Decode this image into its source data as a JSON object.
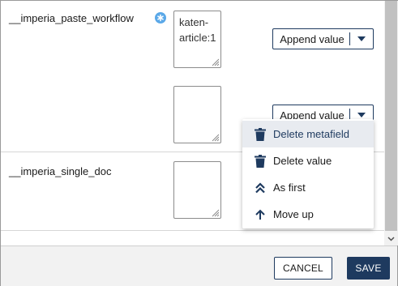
{
  "fields": [
    {
      "label": "__imperia_paste_workflow",
      "has_info_icon": true,
      "values": [
        "katen-article:1",
        ""
      ],
      "append_label": "Append value"
    },
    {
      "label": "__imperia_single_doc",
      "values": [
        ""
      ]
    }
  ],
  "value_menu": {
    "items": [
      {
        "label": "Delete metafield",
        "icon": "trash-icon",
        "active": true
      },
      {
        "label": "Delete value",
        "icon": "trash-icon",
        "active": false
      },
      {
        "label": "As first",
        "icon": "double-chevron-up-icon",
        "active": false
      },
      {
        "label": "Move up",
        "icon": "arrow-up-icon",
        "active": false
      }
    ]
  },
  "footer": {
    "cancel_label": "CANCEL",
    "save_label": "SAVE"
  },
  "colors": {
    "primary": "#1e3a5f",
    "info": "#5aa8e8",
    "menu_active_bg": "#e8ebf0"
  }
}
